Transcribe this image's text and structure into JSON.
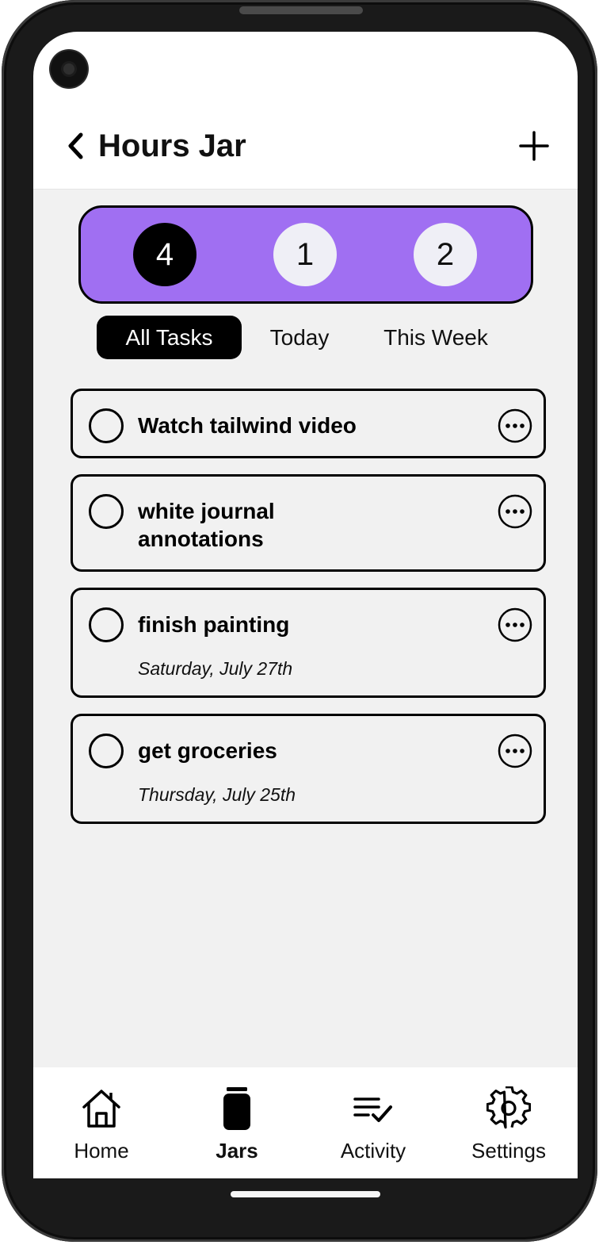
{
  "header": {
    "title": "Hours Jar",
    "back_icon": "chevron-left-icon",
    "add_icon": "plus-icon"
  },
  "counters": [
    {
      "value": "4",
      "active": true
    },
    {
      "value": "1",
      "active": false
    },
    {
      "value": "2",
      "active": false
    }
  ],
  "tabs": [
    {
      "label": "All Tasks",
      "active": true
    },
    {
      "label": "Today",
      "active": false
    },
    {
      "label": "This Week",
      "active": false
    }
  ],
  "tasks": [
    {
      "title": "Watch tailwind video",
      "date": ""
    },
    {
      "title": "white journal annotations",
      "date": ""
    },
    {
      "title": "finish painting",
      "date": "Saturday, July 27th"
    },
    {
      "title": "get groceries",
      "date": "Thursday, July 25th"
    }
  ],
  "nav": [
    {
      "label": "Home",
      "icon": "home-icon",
      "active": false
    },
    {
      "label": "Jars",
      "icon": "jar-icon",
      "active": true
    },
    {
      "label": "Activity",
      "icon": "checklist-icon",
      "active": false
    },
    {
      "label": "Settings",
      "icon": "gear-icon",
      "active": false
    }
  ],
  "colors": {
    "accent": "#a06ff2",
    "background": "#f1f1f1",
    "text": "#000000"
  }
}
